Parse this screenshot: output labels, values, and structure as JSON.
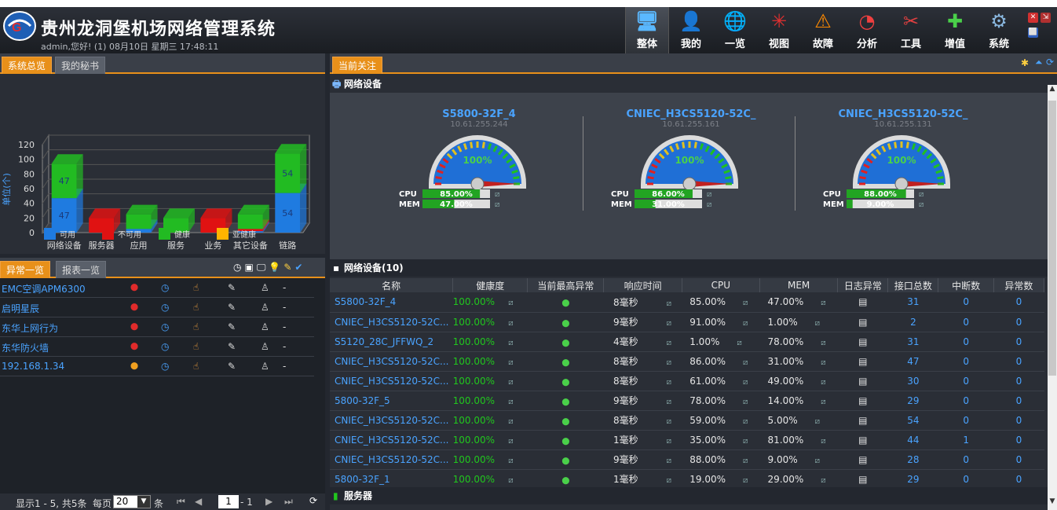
{
  "header": {
    "title": "贵州龙洞堡机场网络管理系统",
    "user_info": "admin,您好! (1) 08月10日 星期三 17:48:11",
    "nav": [
      {
        "label": "整体",
        "icon": "monitor-icon",
        "active": true
      },
      {
        "label": "我的",
        "icon": "user-icon",
        "active": false
      },
      {
        "label": "一览",
        "icon": "globe-icon",
        "active": false
      },
      {
        "label": "视图",
        "icon": "topology-icon",
        "active": false
      },
      {
        "label": "故障",
        "icon": "warning-icon",
        "active": false
      },
      {
        "label": "分析",
        "icon": "pie-chart-icon",
        "active": false
      },
      {
        "label": "工具",
        "icon": "tools-icon",
        "active": false
      },
      {
        "label": "增值",
        "icon": "plus-icon",
        "active": false
      },
      {
        "label": "系统",
        "icon": "gear-icon",
        "active": false
      }
    ]
  },
  "left_top": {
    "tabs": [
      "系统总览",
      "我的秘书"
    ],
    "active_tab": 0
  },
  "chart_data": {
    "type": "bar",
    "ylabel": "单位(个)",
    "ylim": [
      0,
      120
    ],
    "yticks": [
      0,
      20,
      40,
      60,
      80,
      100,
      120
    ],
    "categories": [
      "网络设备",
      "服务器",
      "应用",
      "服务",
      "业务",
      "其它设备",
      "链路"
    ],
    "series": [
      {
        "name": "可用",
        "color": "#1f7be0",
        "values": [
          47,
          0,
          5,
          0,
          0,
          2,
          54
        ]
      },
      {
        "name": "不可用",
        "color": "#e01212",
        "values": [
          0,
          20,
          0,
          0,
          20,
          3,
          0
        ]
      },
      {
        "name": "健康",
        "color": "#22bb22",
        "values": [
          47,
          0,
          20,
          20,
          0,
          20,
          54
        ]
      },
      {
        "name": "亚健康",
        "color": "#ffb400",
        "values": [
          0,
          0,
          0,
          0,
          0,
          0,
          0
        ]
      }
    ],
    "data_labels": [
      {
        "category": "网络设备",
        "series": "可用",
        "text": "47"
      },
      {
        "category": "网络设备",
        "series": "健康",
        "text": "47"
      },
      {
        "category": "链路",
        "series": "可用",
        "text": "54"
      },
      {
        "category": "链路",
        "series": "健康",
        "text": "54"
      }
    ],
    "legend": [
      "可用",
      "不可用",
      "健康",
      "亚健康"
    ]
  },
  "left_bottom": {
    "tabs": [
      "异常一览",
      "报表一览"
    ],
    "active_tab": 0,
    "toolbar_icons": [
      "clock-icon",
      "save-icon",
      "monitor-icon",
      "bulb-icon",
      "edit-icon",
      "check-icon"
    ],
    "alarms": [
      {
        "name": "EMC空调APM6300",
        "pin_color": "#e02b2b",
        "value": "-"
      },
      {
        "name": "启明星辰",
        "pin_color": "#e02b2b",
        "value": "-"
      },
      {
        "name": "东华上网行为",
        "pin_color": "#e02b2b",
        "value": "-"
      },
      {
        "name": "东华防火墙",
        "pin_color": "#e02b2b",
        "value": "-"
      },
      {
        "name": "192.168.1.34",
        "pin_color": "#f0a020",
        "value": "-"
      }
    ],
    "pager": {
      "summary": "显示1 - 5, 共5条",
      "per_page_label": "每页",
      "per_page": "20",
      "unit": "条",
      "page": "1",
      "total": "- 1"
    }
  },
  "right": {
    "tab": "当前关注",
    "section_network": "网络设备",
    "gauges": [
      {
        "name": "S5800-32F_4",
        "ip": "10.61.255.244",
        "health": "100%",
        "health_value": 100,
        "cpu_value": 85,
        "mem_value": 47,
        "cpu": "85.00%",
        "mem": "47.00%"
      },
      {
        "name": "CNIEC_H3CS5120-52C_",
        "ip": "10.61.255.161",
        "health": "100%",
        "health_value": 100,
        "cpu_value": 86,
        "mem_value": 31,
        "cpu": "86.00%",
        "mem": "31.00%"
      },
      {
        "name": "CNIEC_H3CS5120-52C_",
        "ip": "10.61.255.131",
        "health": "100%",
        "health_value": 100,
        "cpu_value": 88,
        "mem_value": 9,
        "cpu": "88.00%",
        "mem": "9.00%"
      }
    ],
    "cpu_label": "CPU",
    "mem_label": "MEM",
    "table_title": "网络设备(10)",
    "columns": [
      "名称",
      "健康度",
      "当前最高异常",
      "响应时间",
      "CPU",
      "MEM",
      "日志异常",
      "接口总数",
      "中断数",
      "异常数"
    ],
    "rows": [
      {
        "name": "S5800-32F_4",
        "health": "100.00%",
        "resp": "8毫秒",
        "cpu": "85.00%",
        "mem": "47.00%",
        "ifaces": "31",
        "down": "0",
        "err": "0"
      },
      {
        "name": "CNIEC_H3CS5120-52C...",
        "health": "100.00%",
        "resp": "9毫秒",
        "cpu": "91.00%",
        "mem": "1.00%",
        "ifaces": "2",
        "down": "0",
        "err": "0"
      },
      {
        "name": "S5120_28C_JFFWQ_2",
        "health": "100.00%",
        "resp": "4毫秒",
        "cpu": "1.00%",
        "mem": "78.00%",
        "ifaces": "31",
        "down": "0",
        "err": "0"
      },
      {
        "name": "CNIEC_H3CS5120-52C...",
        "health": "100.00%",
        "resp": "8毫秒",
        "cpu": "86.00%",
        "mem": "31.00%",
        "ifaces": "47",
        "down": "0",
        "err": "0"
      },
      {
        "name": "CNIEC_H3CS5120-52C...",
        "health": "100.00%",
        "resp": "8毫秒",
        "cpu": "61.00%",
        "mem": "49.00%",
        "ifaces": "30",
        "down": "0",
        "err": "0"
      },
      {
        "name": "5800-32F_5",
        "health": "100.00%",
        "resp": "9毫秒",
        "cpu": "78.00%",
        "mem": "14.00%",
        "ifaces": "29",
        "down": "0",
        "err": "0"
      },
      {
        "name": "CNIEC_H3CS5120-52C...",
        "health": "100.00%",
        "resp": "8毫秒",
        "cpu": "59.00%",
        "mem": "5.00%",
        "ifaces": "54",
        "down": "0",
        "err": "0"
      },
      {
        "name": "CNIEC_H3CS5120-52C...",
        "health": "100.00%",
        "resp": "1毫秒",
        "cpu": "35.00%",
        "mem": "81.00%",
        "ifaces": "44",
        "down": "1",
        "err": "0"
      },
      {
        "name": "CNIEC_H3CS5120-52C...",
        "health": "100.00%",
        "resp": "9毫秒",
        "cpu": "88.00%",
        "mem": "9.00%",
        "ifaces": "28",
        "down": "0",
        "err": "0"
      },
      {
        "name": "5800-32F_1",
        "health": "100.00%",
        "resp": "1毫秒",
        "cpu": "19.00%",
        "mem": "29.00%",
        "ifaces": "29",
        "down": "0",
        "err": "0"
      }
    ],
    "section_server": "服务器"
  }
}
